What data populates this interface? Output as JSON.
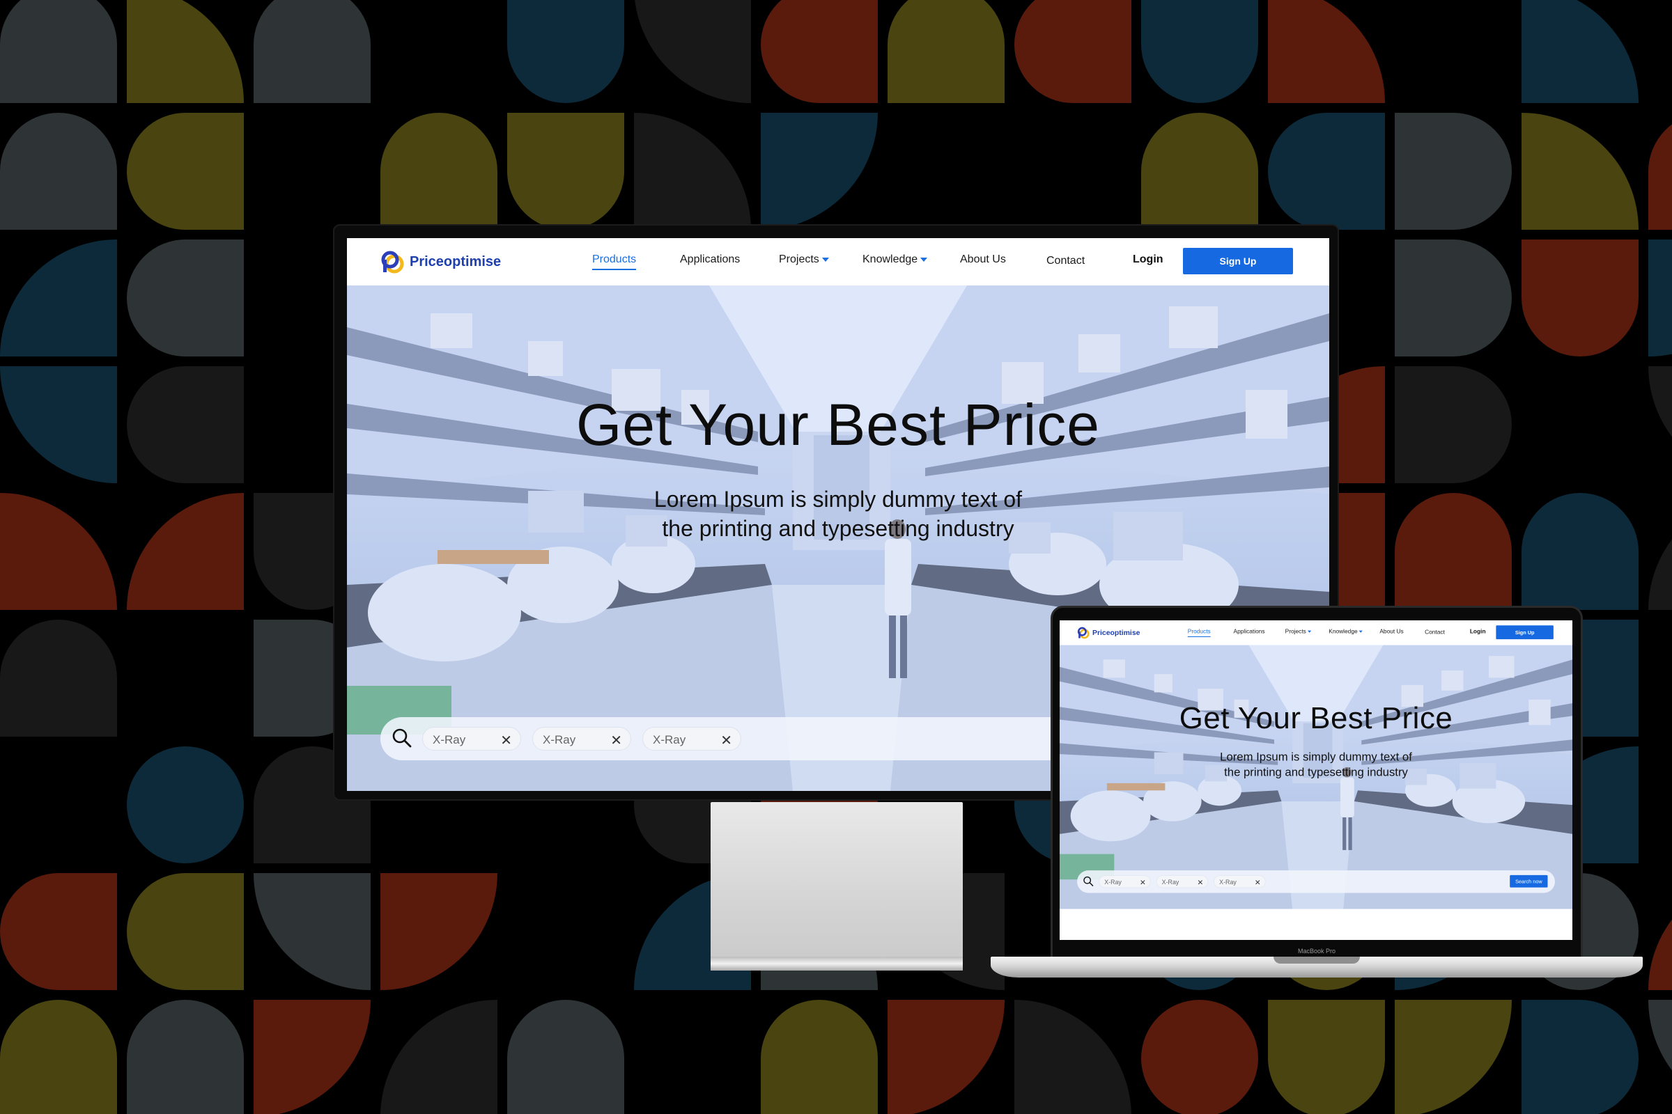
{
  "site": {
    "brand": "Priceoptimise",
    "nav": {
      "products": "Products",
      "applications": "Applications",
      "projects": "Projects",
      "knowledge": "Knowledge",
      "about": "About Us",
      "contact": "Contact",
      "login": "Login",
      "signup": "Sign Up"
    },
    "hero": {
      "title": "Get Your Best Price",
      "subtitle_line1": "Lorem Ipsum is simply dummy text of",
      "subtitle_line2": "the printing and typesetting industry"
    },
    "search": {
      "chips": [
        "X-Ray",
        "X-Ray",
        "X-Ray"
      ],
      "button": "Search now"
    }
  },
  "laptop": {
    "model": "MacBook Pro"
  },
  "colors": {
    "accent": "#1669e0",
    "brand": "#1e3fae",
    "logo_gold": "#f2b81c",
    "pattern": [
      "#5a1a0c",
      "#4a4410",
      "#0d2a3a",
      "#2e3336",
      "#181818"
    ]
  },
  "icons": {
    "search": "search-icon",
    "remove_chip": "close-icon",
    "dropdown": "caret-down-icon"
  }
}
